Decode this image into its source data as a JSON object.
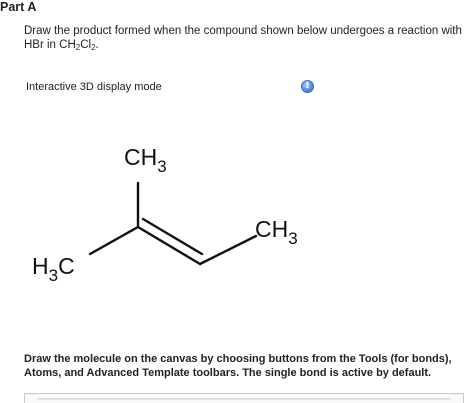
{
  "part": {
    "title": "Part A"
  },
  "question": {
    "line1": "Draw the product formed when the compound shown below undergoes a reaction with",
    "line2_prefix": "HBr in CH",
    "line2_sub1": "2",
    "line2_mid": "Cl",
    "line2_sub2": "2",
    "line2_suffix": "."
  },
  "display": {
    "mode_label": "Interactive 3D display mode",
    "info_icon": "info-icon",
    "info_glyph": "i"
  },
  "molecule": {
    "top_group": "CH",
    "top_sub": "3",
    "right_group": "CH",
    "right_sub": "3",
    "left_prefix": "H",
    "left_sub": "3",
    "left_suffix": "C"
  },
  "instructions": {
    "text": "Draw the molecule on the canvas by choosing buttons from the Tools (for bonds), Atoms, and Advanced Template toolbars. The single bond is active by default."
  },
  "colors": {
    "text": "#222222",
    "info_blue": "#5b8fe0",
    "bond": "#111111"
  }
}
